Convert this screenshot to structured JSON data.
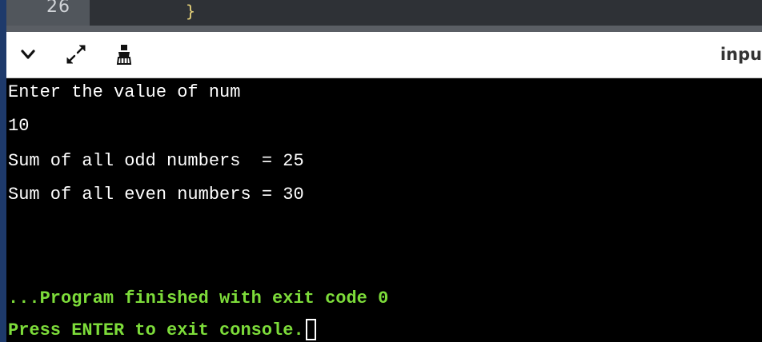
{
  "editor": {
    "line_number": "26",
    "code_line": "}"
  },
  "toolbar": {
    "collapse_icon": "chevron-down-icon",
    "expand_icon": "expand-icon",
    "clear_icon": "clear-console-icon",
    "input_tab_label": "inpu"
  },
  "console": {
    "lines": [
      "Enter the value of num",
      "10",
      "Sum of all odd numbers  = 25",
      "Sum of all even numbers = 30"
    ],
    "status_line": "...Program finished with exit code 0",
    "prompt_line": "Press ENTER to exit console."
  },
  "colors": {
    "console_bg": "#000000",
    "output_text": "#ffffff",
    "status_text": "#7ddc3a",
    "toolbar_bg": "#ffffff"
  }
}
